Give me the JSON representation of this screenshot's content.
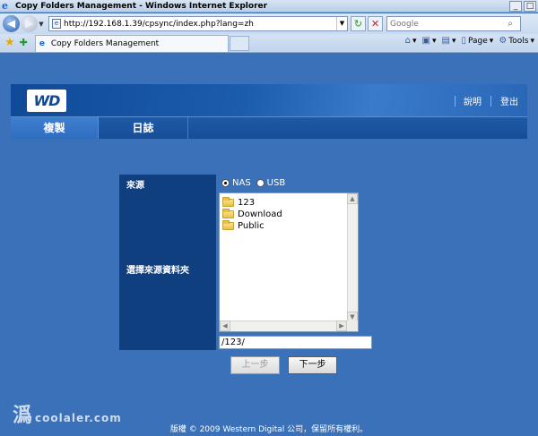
{
  "browser": {
    "window_title": "Copy Folders Management - Windows Internet Explorer",
    "url": "http://192.168.1.39/cpsync/index.php?lang=zh",
    "search_placeholder": "Google",
    "tab_title": "Copy Folders Management",
    "commands": {
      "page": "Page",
      "tools": "Tools"
    },
    "window_buttons": {
      "minimize": "_",
      "maximize": "□",
      "close": "X"
    }
  },
  "header": {
    "logo_text": "WD",
    "links": {
      "help": "說明",
      "logout": "登出"
    }
  },
  "nav": {
    "tabs": [
      {
        "label": "複製",
        "active": true
      },
      {
        "label": "日誌",
        "active": false
      }
    ]
  },
  "form": {
    "source_label": "來源",
    "folder_label": "選擇來源資料夾",
    "radio_options": [
      {
        "label": "NAS",
        "selected": true
      },
      {
        "label": "USB",
        "selected": false
      }
    ],
    "folders": [
      "123",
      "Download",
      "Public"
    ],
    "path_value": "/123/",
    "buttons": {
      "prev": "上一步",
      "next": "下一步"
    }
  },
  "footer": {
    "copyright": "版權 © 2009 Western Digital 公司，保留所有權利。"
  },
  "watermark": "coolaler.com",
  "colors": {
    "page_bg": "#3a71b8",
    "label_bg": "#103f80",
    "header_dark": "#0f4a98"
  }
}
